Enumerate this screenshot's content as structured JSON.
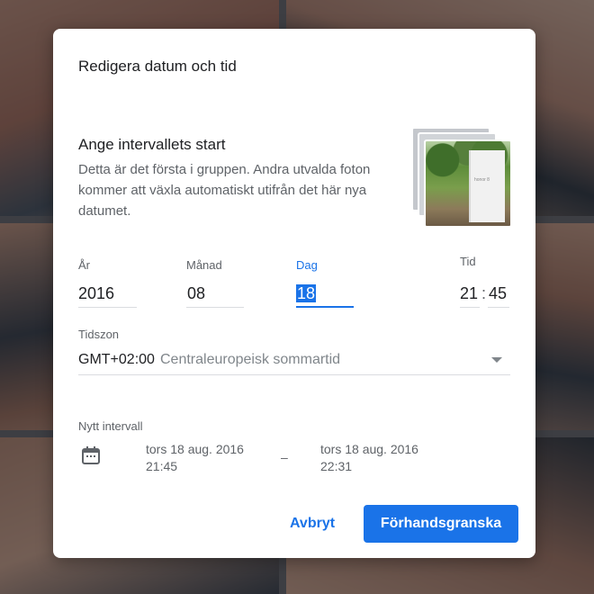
{
  "dialog": {
    "title": "Redigera datum och tid",
    "section_heading": "Ange intervallets start",
    "section_description": "Detta är det första i gruppen. Andra utvalda foton kommer att växla automatiskt utifrån det här nya datumet.",
    "thumbnail_box_text": "honor 8"
  },
  "date": {
    "year_label": "År",
    "year_value": "2016",
    "month_label": "Månad",
    "month_value": "08",
    "day_label": "Dag",
    "day_value": "18",
    "time_label": "Tid",
    "hour_value": "21",
    "time_separator": ":",
    "minute_value": "45"
  },
  "timezone": {
    "label": "Tidszon",
    "offset": "GMT+02:00",
    "name": "Centraleuropeisk sommartid"
  },
  "interval": {
    "label": "Nytt intervall",
    "start_date": "tors 18 aug. 2016",
    "start_time": "21:45",
    "separator": "–",
    "end_date": "tors 18 aug. 2016",
    "end_time": "22:31"
  },
  "buttons": {
    "cancel": "Avbryt",
    "preview": "Förhandsgranska"
  },
  "colors": {
    "accent": "#1a73e8",
    "scrim": "#202124"
  },
  "icons": {
    "calendar": "calendar-icon",
    "dropdown": "dropdown-caret-icon"
  }
}
